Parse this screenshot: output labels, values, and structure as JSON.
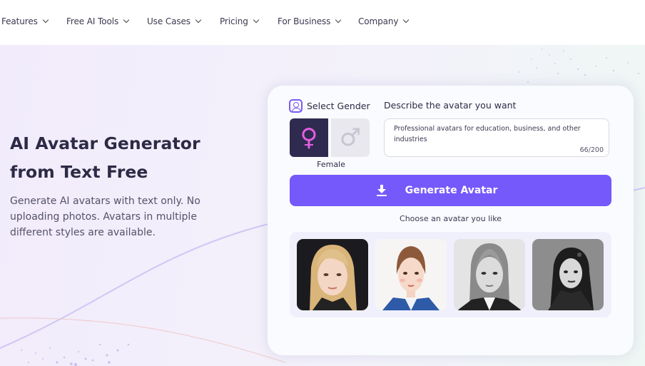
{
  "nav": {
    "items": [
      {
        "label": "Features"
      },
      {
        "label": "Free AI Tools"
      },
      {
        "label": "Use Cases"
      },
      {
        "label": "Pricing"
      },
      {
        "label": "For Business"
      },
      {
        "label": "Company"
      }
    ]
  },
  "hero": {
    "title_line1": "AI Avatar Generator",
    "title_line2": "from Text Free",
    "subtitle": "Generate AI avatars with text only. No uploading photos. Avatars in multiple different styles are available."
  },
  "generator": {
    "gender_label": "Select Gender",
    "gender_options": [
      {
        "name": "female",
        "glyph": "♀",
        "selected": true
      },
      {
        "name": "male",
        "glyph": "♂",
        "selected": false
      }
    ],
    "gender_caption": "Female",
    "description_label": "Describe the avatar you want",
    "description_value": "Professional avatars for education, business, and other industries",
    "char_count": "66/200",
    "generate_label": "Generate Avatar",
    "choose_label": "Choose an avatar you like",
    "avatars": [
      {
        "style": "3d-blonde",
        "alt": "Blonde 3D avatar"
      },
      {
        "style": "watercolor",
        "alt": "Watercolor avatar"
      },
      {
        "style": "grayscale-realistic",
        "alt": "Grayscale realistic avatar"
      },
      {
        "style": "gothic",
        "alt": "Gothic avatar"
      }
    ],
    "accent_color": "#7559fa",
    "dark_color": "#2f2a4f",
    "female_color": "#e45ee0"
  }
}
